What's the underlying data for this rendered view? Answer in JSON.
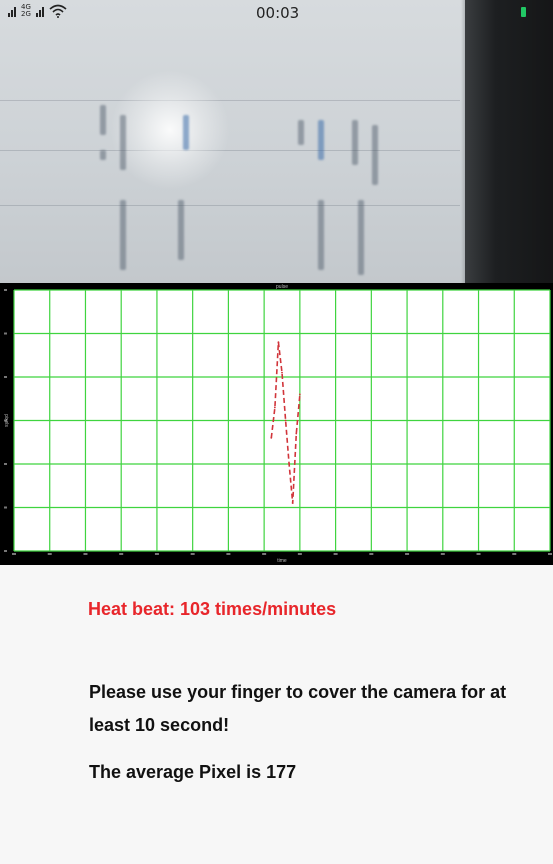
{
  "status_bar": {
    "network_1": "4G",
    "network_2": "2G",
    "time": "00:03",
    "battery_color": "#21c764"
  },
  "camera_preview": {
    "description_icon": "camera-preview"
  },
  "chart_data": {
    "type": "line",
    "title": "pulse",
    "xlabel": "time",
    "ylabel": "pixels",
    "grid": true,
    "grid_color": "#3fd43f",
    "line_color": "#d1343a",
    "line_style": "dashed",
    "series": [
      {
        "x": [
          72,
          73,
          74,
          75,
          76,
          77,
          78,
          79,
          80
        ],
        "values": [
          2.6,
          3.3,
          4.8,
          4.1,
          3.0,
          2.0,
          1.1,
          2.7,
          3.6
        ]
      }
    ]
  },
  "info": {
    "heartbeat": "Heat beat: 103 times/minutes",
    "instruction": "Please use your finger to cover the camera for at least 10 second!",
    "average": "The average Pixel is 177"
  },
  "colors": {
    "heartbeat_text": "#e8262b",
    "body_text": "#111111"
  }
}
